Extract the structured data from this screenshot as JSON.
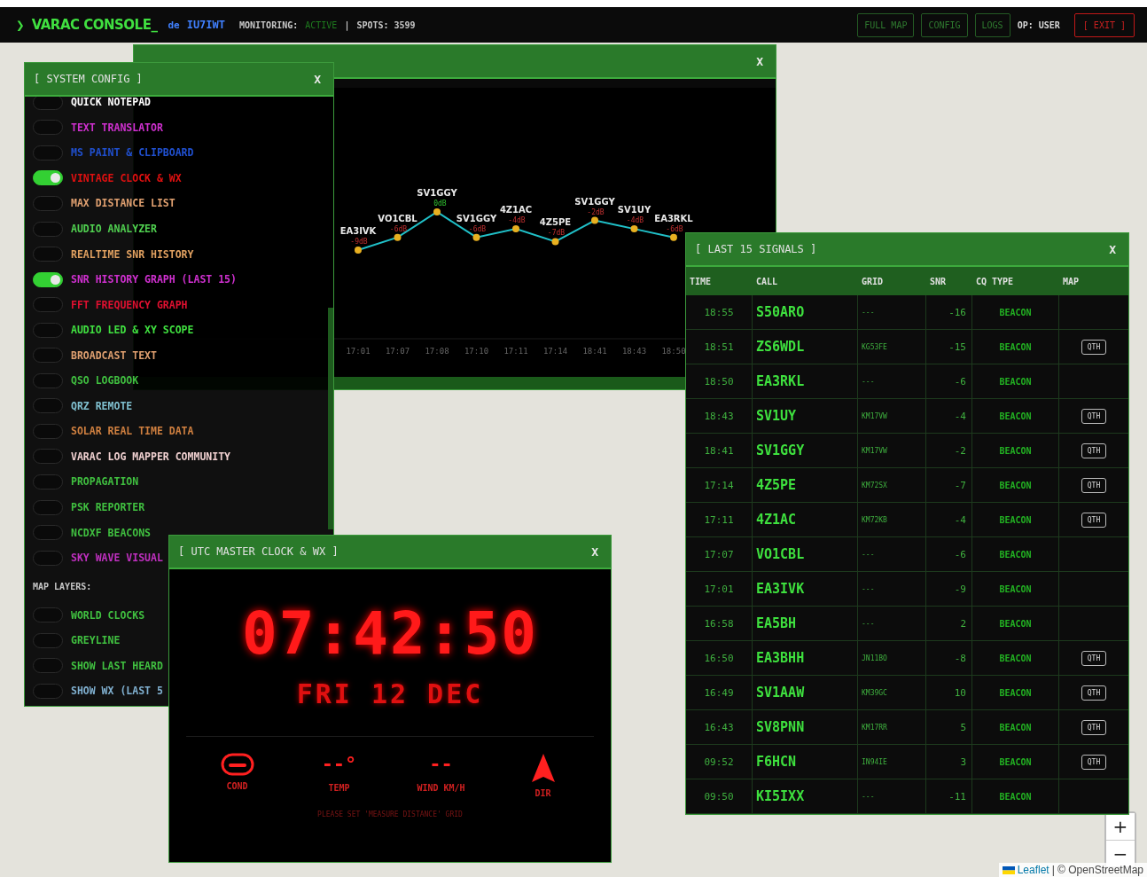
{
  "top_bar": {
    "prompt": "❯",
    "title": "VARAC CONSOLE_",
    "de": "de",
    "callsign": "IU7IWT",
    "monitoring_label": "MONITORING:",
    "monitoring_status": "ACTIVE",
    "separator": "|",
    "spots": "SPOTS: 3599",
    "buttons": [
      {
        "label": "FULL MAP",
        "kind": "nav"
      },
      {
        "label": "CONFIG",
        "kind": "nav"
      },
      {
        "label": "LOGS",
        "kind": "nav"
      },
      {
        "label": "OP: USER",
        "kind": "text"
      },
      {
        "label": "[ EXIT ]",
        "kind": "exit"
      }
    ]
  },
  "config": {
    "title": "[ SYSTEM CONFIG ]",
    "close": "X",
    "items": [
      {
        "label": "QUICK NOTEPAD",
        "color": "#ffffff",
        "on": false
      },
      {
        "label": "TEXT TRANSLATOR",
        "color": "#d030d0",
        "on": false
      },
      {
        "label": "MS PAINT & CLIPBOARD",
        "color": "#2050d0",
        "on": false
      },
      {
        "label": "VINTAGE CLOCK & WX",
        "color": "#e01010",
        "on": true
      },
      {
        "label": "MAX DISTANCE LIST",
        "color": "#e0a070",
        "on": false
      },
      {
        "label": "AUDIO ANALYZER",
        "color": "#50d050",
        "on": false
      },
      {
        "label": "REALTIME SNR HISTORY",
        "color": "#e0a060",
        "on": false
      },
      {
        "label": "SNR HISTORY GRAPH (LAST 15)",
        "color": "#d030d0",
        "on": true
      },
      {
        "label": "FFT FREQUENCY GRAPH",
        "color": "#e01030",
        "on": false
      },
      {
        "label": "AUDIO LED & XY SCOPE",
        "color": "#40e040",
        "on": false
      },
      {
        "label": "BROADCAST TEXT",
        "color": "#e0a070",
        "on": false
      },
      {
        "label": "QSO LOGBOOK",
        "color": "#40c040",
        "on": false
      },
      {
        "label": "QRZ REMOTE",
        "color": "#80c0d0",
        "on": false
      },
      {
        "label": "SOLAR REAL TIME DATA",
        "color": "#d08040",
        "on": false
      },
      {
        "label": "VARAC LOG MAPPER COMMUNITY",
        "color": "#f0d0d0",
        "on": false
      },
      {
        "label": "PROPAGATION",
        "color": "#40c040",
        "on": false
      },
      {
        "label": "PSK REPORTER",
        "color": "#40c040",
        "on": false
      },
      {
        "label": "NCDXF BEACONS",
        "color": "#40c040",
        "on": false
      },
      {
        "label": "SKY WAVE VISUAL",
        "color": "#c030c0",
        "on": false
      }
    ],
    "map_layers_label": "MAP LAYERS:",
    "map_layers": [
      {
        "label": "WORLD CLOCKS",
        "color": "#40c040",
        "on": false
      },
      {
        "label": "GREYLINE",
        "color": "#40c040",
        "on": false
      },
      {
        "label": "SHOW LAST HEARD",
        "color": "#40c040",
        "on": false
      },
      {
        "label": "SHOW WX (LAST 5",
        "color": "#80b0d0",
        "on": false
      }
    ]
  },
  "snr_window": {
    "close": "X",
    "value_units": [
      "dB",
      "dB",
      "dB",
      "dB",
      "dB",
      "dB",
      "dB",
      "dB",
      "dB"
    ],
    "chart_data": {
      "type": "line",
      "categories": [
        "17:01",
        "17:07",
        "17:08",
        "17:10",
        "17:11",
        "17:14",
        "18:41",
        "18:43",
        "18:50"
      ],
      "series": [
        {
          "color": "#20c0c8",
          "marker": "circle",
          "values": [
            -9,
            -6,
            0,
            -6,
            -4,
            -7,
            -2,
            -4,
            -6
          ]
        }
      ],
      "data_labels": true,
      "annotations": [
        "EA3IVK",
        "VO1CBL",
        "SV1GGY",
        "SV1GGY",
        "4Z1AC",
        "4Z5PE",
        "SV1GGY",
        "SV1UY",
        "EA3RKL"
      ]
    }
  },
  "clock": {
    "title": "[ UTC MASTER CLOCK & WX ]",
    "close": "X",
    "time": "07:42:50",
    "date": "FRI 12 DEC",
    "weather": [
      {
        "kind": "cond_icon",
        "label": "COND"
      },
      {
        "kind": "value",
        "value": "--°",
        "label": "TEMP"
      },
      {
        "kind": "value",
        "value": "--",
        "label": "WIND KM/H"
      },
      {
        "kind": "dir_icon",
        "label": "DIR"
      }
    ],
    "notice": "PLEASE SET 'MEASURE DISTANCE' GRID"
  },
  "signals": {
    "title": "[ LAST 15 SIGNALS ]",
    "close": "X",
    "columns": [
      "TIME",
      "CALL",
      "GRID",
      "SNR",
      "CQ TYPE",
      "MAP"
    ],
    "rows": [
      {
        "time": "18:55",
        "call": "S50ARO",
        "grid": "---",
        "snr": "-16",
        "cq_type": "BEACON"
      },
      {
        "time": "18:51",
        "call": "ZS6WDL",
        "grid": "KG53FE",
        "snr": "-15",
        "cq_type": "BEACON",
        "map_button": "QTH"
      },
      {
        "time": "18:50",
        "call": "EA3RKL",
        "grid": "---",
        "snr": "-6",
        "cq_type": "BEACON"
      },
      {
        "time": "18:43",
        "call": "SV1UY",
        "grid": "KM17VW",
        "snr": "-4",
        "cq_type": "BEACON",
        "map_button": "QTH"
      },
      {
        "time": "18:41",
        "call": "SV1GGY",
        "grid": "KM17VW",
        "snr": "-2",
        "cq_type": "BEACON",
        "map_button": "QTH"
      },
      {
        "time": "17:14",
        "call": "4Z5PE",
        "grid": "KM72SX",
        "snr": "-7",
        "cq_type": "BEACON",
        "map_button": "QTH"
      },
      {
        "time": "17:11",
        "call": "4Z1AC",
        "grid": "KM72KB",
        "snr": "-4",
        "cq_type": "BEACON",
        "map_button": "QTH"
      },
      {
        "time": "17:07",
        "call": "VO1CBL",
        "grid": "---",
        "snr": "-6",
        "cq_type": "BEACON"
      },
      {
        "time": "17:01",
        "call": "EA3IVK",
        "grid": "---",
        "snr": "-9",
        "cq_type": "BEACON"
      },
      {
        "time": "16:58",
        "call": "EA5BH",
        "grid": "---",
        "snr": "2",
        "cq_type": "BEACON"
      },
      {
        "time": "16:50",
        "call": "EA3BHH",
        "grid": "JN11BO",
        "snr": "-8",
        "cq_type": "BEACON",
        "map_button": "QTH"
      },
      {
        "time": "16:49",
        "call": "SV1AAW",
        "grid": "KM39GC",
        "snr": "10",
        "cq_type": "BEACON",
        "map_button": "QTH"
      },
      {
        "time": "16:43",
        "call": "SV8PNN",
        "grid": "KM17RR",
        "snr": "5",
        "cq_type": "BEACON",
        "map_button": "QTH"
      },
      {
        "time": "09:52",
        "call": "F6HCN",
        "grid": "IN94IE",
        "snr": "3",
        "cq_type": "BEACON",
        "map_button": "QTH"
      },
      {
        "time": "09:50",
        "call": "KI5IXX",
        "grid": "---",
        "snr": "-11",
        "cq_type": "BEACON"
      }
    ]
  },
  "map": {
    "zoom_in": "+",
    "zoom_out": "−",
    "attribution_link": "Leaflet",
    "attribution": "| © OpenStreetMap"
  }
}
